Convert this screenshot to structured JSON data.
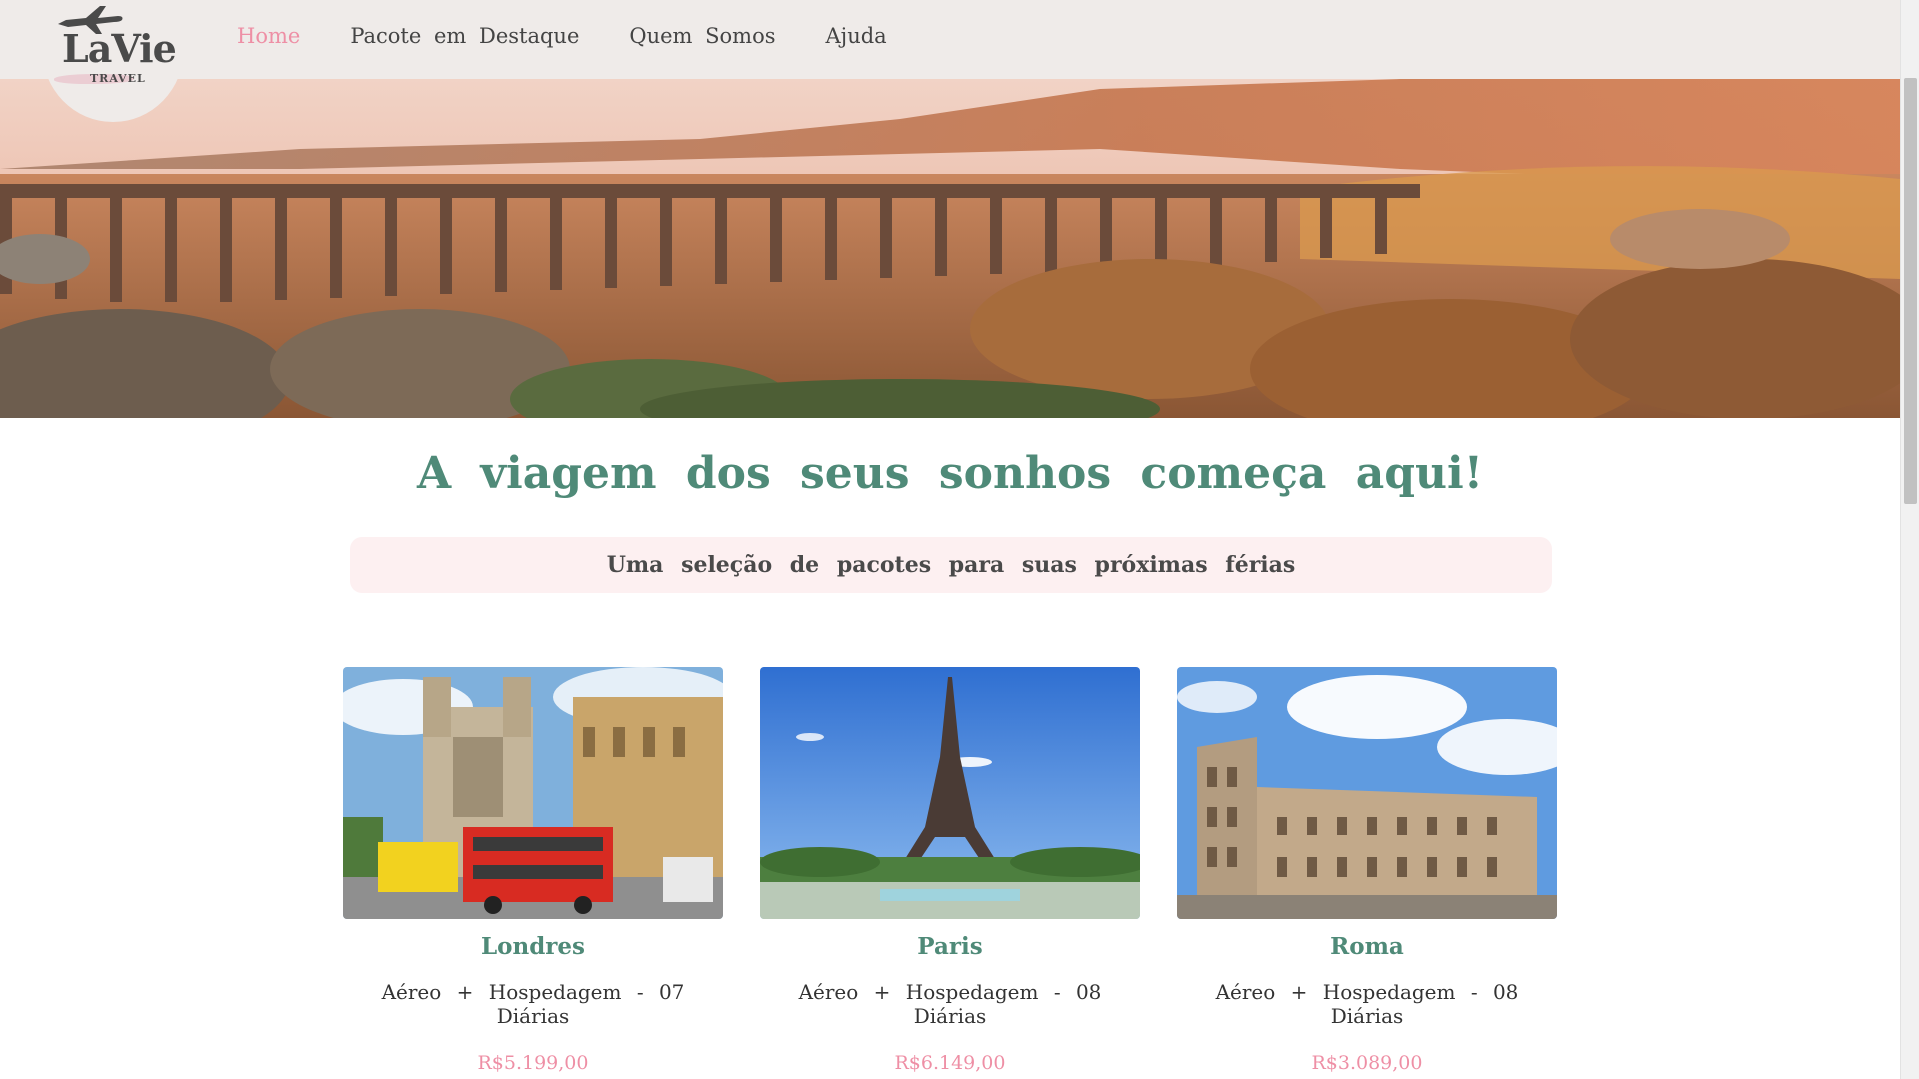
{
  "brand": {
    "name": "LaVie",
    "tagline": "TRAVEL"
  },
  "nav": {
    "items": [
      {
        "label": "Home",
        "active": true
      },
      {
        "label": "Pacote em Destaque",
        "active": false
      },
      {
        "label": "Quem Somos",
        "active": false
      },
      {
        "label": "Ajuda",
        "active": false
      }
    ]
  },
  "hero": {
    "icon": "viaduct-landscape-banner"
  },
  "main": {
    "headline": "A viagem dos seus sonhos começa aqui!",
    "subtitle": "Uma seleção de pacotes para suas próximas férias"
  },
  "packages": [
    {
      "city": "Londres",
      "description": "Aéreo + Hospedagem - 07 Diárias",
      "price": "R$5.199,00",
      "icon": "london-westminster-bus-photo"
    },
    {
      "city": "Paris",
      "description": "Aéreo + Hospedagem - 08 Diárias",
      "price": "R$6.149,00",
      "icon": "paris-eiffel-tower-photo"
    },
    {
      "city": "Roma",
      "description": "Aéreo + Hospedagem - 08 Diárias",
      "price": "R$3.089,00",
      "icon": "rome-colosseum-photo"
    }
  ],
  "colors": {
    "accent_pink": "#ee8fa5",
    "heading_green": "#4f8a78",
    "nav_bg": "#efebe9",
    "subtitle_bg": "#fdf0f1"
  }
}
